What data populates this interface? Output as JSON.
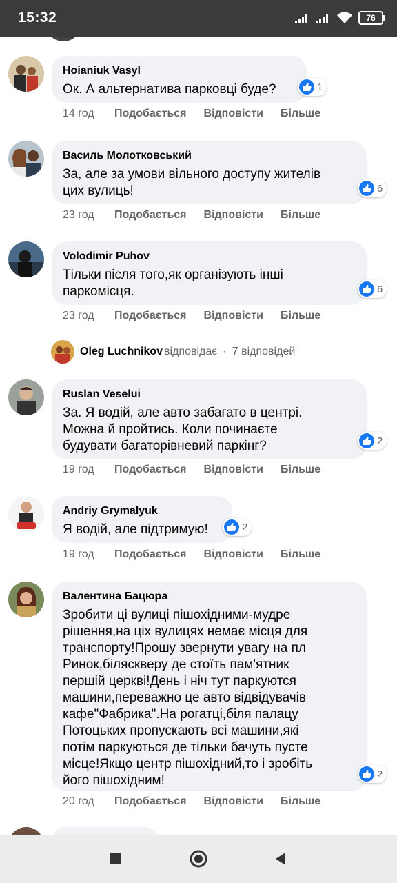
{
  "status_bar": {
    "time": "15:32",
    "battery": "76",
    "icons": [
      "signal-icon",
      "signal-icon",
      "wifi-icon",
      "battery-icon"
    ]
  },
  "actions": {
    "like": "Подобається",
    "reply": "Відповісти",
    "more": "Більше"
  },
  "comments": [
    {
      "author": "Hoianiuk Vasyl",
      "text": "Ок. А альтернатива парковці буде?",
      "time": "14 год",
      "reactions": "1"
    },
    {
      "author": "Василь Молотковський",
      "text": "За, але за умови вільного доступу жителів\nцих вулиць!",
      "time": "23 год",
      "reactions": "6"
    },
    {
      "author": "Volodimir Puhov",
      "text": "Тільки після того,як організують інші\nпаркомісця.",
      "time": "23 год",
      "reactions": "6"
    },
    {
      "author": "Ruslan Veselui",
      "text": "За. Я водій, але авто забагато в центрі.\nМожна й пройтись. Коли починаєте\nбудувати багаторівневий паркінг?",
      "time": "19 год",
      "reactions": "2"
    },
    {
      "author": "Andriy Grymalyuk",
      "text": "Я водій, але підтримую!",
      "time": "19 год",
      "reactions": "2"
    },
    {
      "author": "Валентина Бацюра",
      "text": "Зробити ці вулиці пішохідними-мудре\nрішення,на ціх вулицях немає місця для\nтранспорту!Прошу звернути увагу на пл\nРинок,біляскверу де стоїть пам'ятник\nпершій церкві!День і ніч тут паркуются\nмашини,переважно це авто відвідувачів\nкафе\"Фабрика\".На рогатці,біля палацу\nПотоцьких пропускають всі машини,які\nпотім паркуються де тільки бачуть пусте\nмісце!Якщо центр пішохідний,то і зробіть\nйого пішохідним!",
      "time": "20 год",
      "reactions": "2"
    }
  ],
  "replies_summary": {
    "name": "Oleg Luchnikov",
    "action": "відповідає",
    "sep": "·",
    "count": "7 відповідей"
  }
}
